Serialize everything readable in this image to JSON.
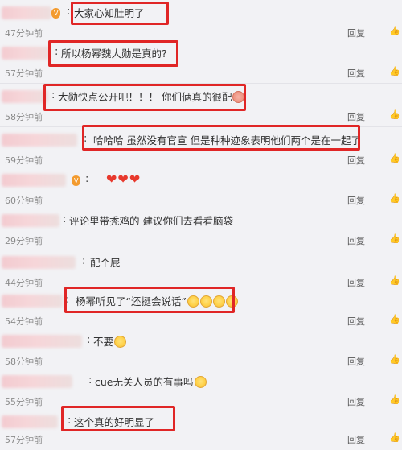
{
  "comments": [
    {
      "text": "大家心知肚明了",
      "emojis": [],
      "hearts": 0,
      "badge": "V",
      "time": "47分钟前",
      "highlighted": true
    },
    {
      "text": "所以杨幂魏大勋是真的?",
      "emojis": [],
      "hearts": 0,
      "badge": "",
      "time": "57分钟前",
      "highlighted": true
    },
    {
      "text": "大勋快点公开吧！！！ 你们俩真的很配",
      "emojis": [
        "pig-face"
      ],
      "hearts": 0,
      "badge": "",
      "time": "58分钟前",
      "highlighted": true
    },
    {
      "text": "哈哈哈  虽然没有官宣  但是种种迹象表明他们两个是在一起了",
      "emojis": [],
      "hearts": 0,
      "badge": "",
      "time": "59分钟前",
      "highlighted": true
    },
    {
      "text": "",
      "emojis": [],
      "hearts": 3,
      "badge": "V",
      "time": "60分钟前",
      "highlighted": false
    },
    {
      "text": "评论里带秃鸡的  建议你们去看看脑袋",
      "emojis": [],
      "hearts": 0,
      "badge": "",
      "time": "29分钟前",
      "highlighted": false
    },
    {
      "text": "配个屁",
      "emojis": [],
      "hearts": 0,
      "badge": "",
      "time": "44分钟前",
      "highlighted": false
    },
    {
      "text": "杨幂听见了“还挺会说话”",
      "emojis": [
        "grin",
        "grin",
        "grin",
        "grin"
      ],
      "hearts": 0,
      "badge": "",
      "time": "54分钟前",
      "highlighted": true
    },
    {
      "text": "不要",
      "emojis": [
        "tear-face"
      ],
      "hearts": 0,
      "badge": "",
      "time": "58分钟前",
      "highlighted": false
    },
    {
      "text": "cue无关人员的有事吗",
      "emojis": [
        "smirk"
      ],
      "hearts": 0,
      "badge": "",
      "time": "55分钟前",
      "highlighted": false
    },
    {
      "text": "这个真的好明显了",
      "emojis": [],
      "hearts": 0,
      "badge": "",
      "time": "57分钟前",
      "highlighted": true
    }
  ],
  "actions": {
    "reply_label": "回复",
    "like_icon": "thumbs-up-icon"
  },
  "colors": {
    "highlight": "#e02626",
    "heart": "#e8392d",
    "badge": "#f39b2f"
  }
}
